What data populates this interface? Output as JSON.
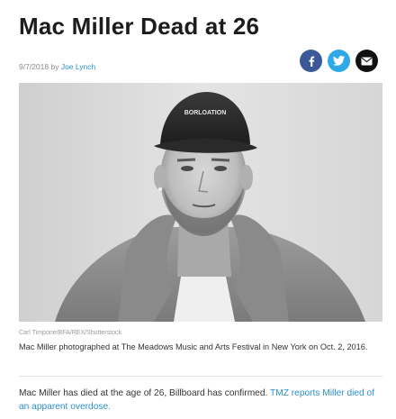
{
  "article": {
    "headline": "Mac Miller Dead at 26",
    "date": "9/7/2018",
    "by_label": "by",
    "author": "Joe Lynch"
  },
  "share": {
    "icons": [
      "facebook-icon",
      "twitter-icon",
      "email-icon"
    ],
    "colors": {
      "facebook": "#3b5998",
      "twitter": "#2fa8e8",
      "email": "#111111"
    }
  },
  "photo": {
    "cap_text": "BORLOATION",
    "credit": "Carl Timpone/BFA/REX/Shutterstock",
    "caption": "Mac Miller photographed at The Meadows Music and Arts Festival in New York on Oct. 2, 2016."
  },
  "body": {
    "text": "Mac Miller has died at the age of 26, Billboard has confirmed.",
    "link_text": "TMZ reports Miller died of an apparent overdose.",
    "link_color": "#2b8fcf"
  }
}
